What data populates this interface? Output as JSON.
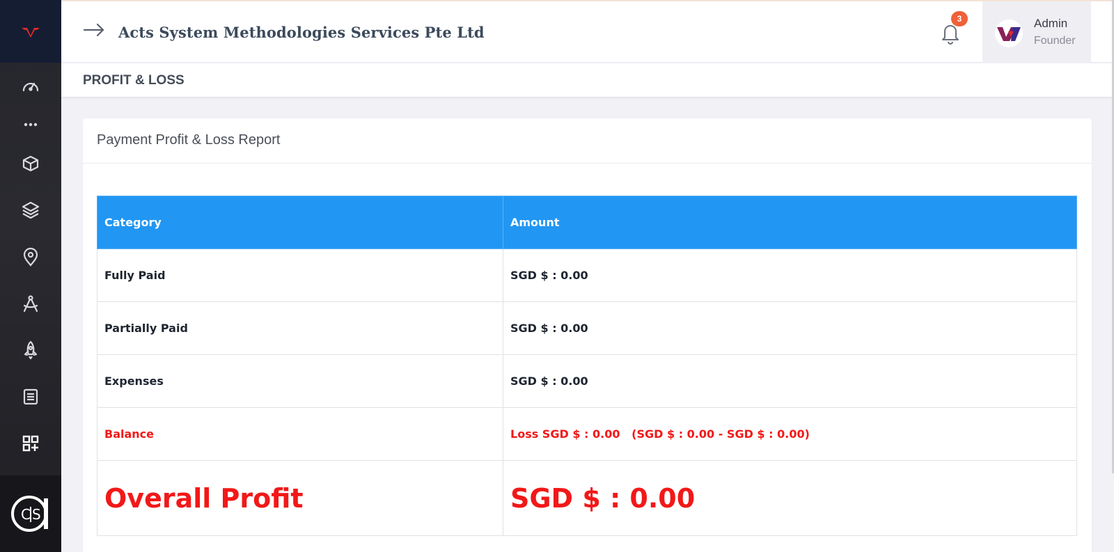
{
  "header": {
    "company_name": "Acts System Methodologies Services Pte Ltd",
    "notification_count": "3",
    "user": {
      "name": "Admin",
      "role": "Founder"
    }
  },
  "sidebar": {
    "items": [
      {
        "icon": "dashboard-gauge-icon"
      },
      {
        "icon": "more-dots-icon"
      },
      {
        "icon": "cube-icon"
      },
      {
        "icon": "layers-icon"
      },
      {
        "icon": "map-pin-icon"
      },
      {
        "icon": "drafting-compass-icon"
      },
      {
        "icon": "rocket-icon"
      },
      {
        "icon": "document-list-icon"
      },
      {
        "icon": "add-widgets-icon"
      }
    ]
  },
  "page": {
    "title": "PROFIT & LOSS"
  },
  "report": {
    "title": "Payment Profit & Loss Report",
    "columns": [
      "Category",
      "Amount"
    ],
    "rows": [
      {
        "category": "Fully Paid",
        "amount": "SGD $ : 0.00"
      },
      {
        "category": "Partially Paid",
        "amount": "SGD $ : 0.00"
      },
      {
        "category": "Expenses",
        "amount": "SGD $ : 0.00"
      }
    ],
    "balance": {
      "label": "Balance",
      "amount": "Loss SGD $ : 0.00   (SGD $ : 0.00 - SGD $ : 0.00)"
    },
    "overall": {
      "label": "Overall Profit",
      "amount": "SGD $ : 0.00"
    }
  },
  "colors": {
    "accent_blue": "#2196f3",
    "negative_red": "#f21818",
    "badge_orange": "#f0613a",
    "sidebar_dark": "#25252c"
  }
}
